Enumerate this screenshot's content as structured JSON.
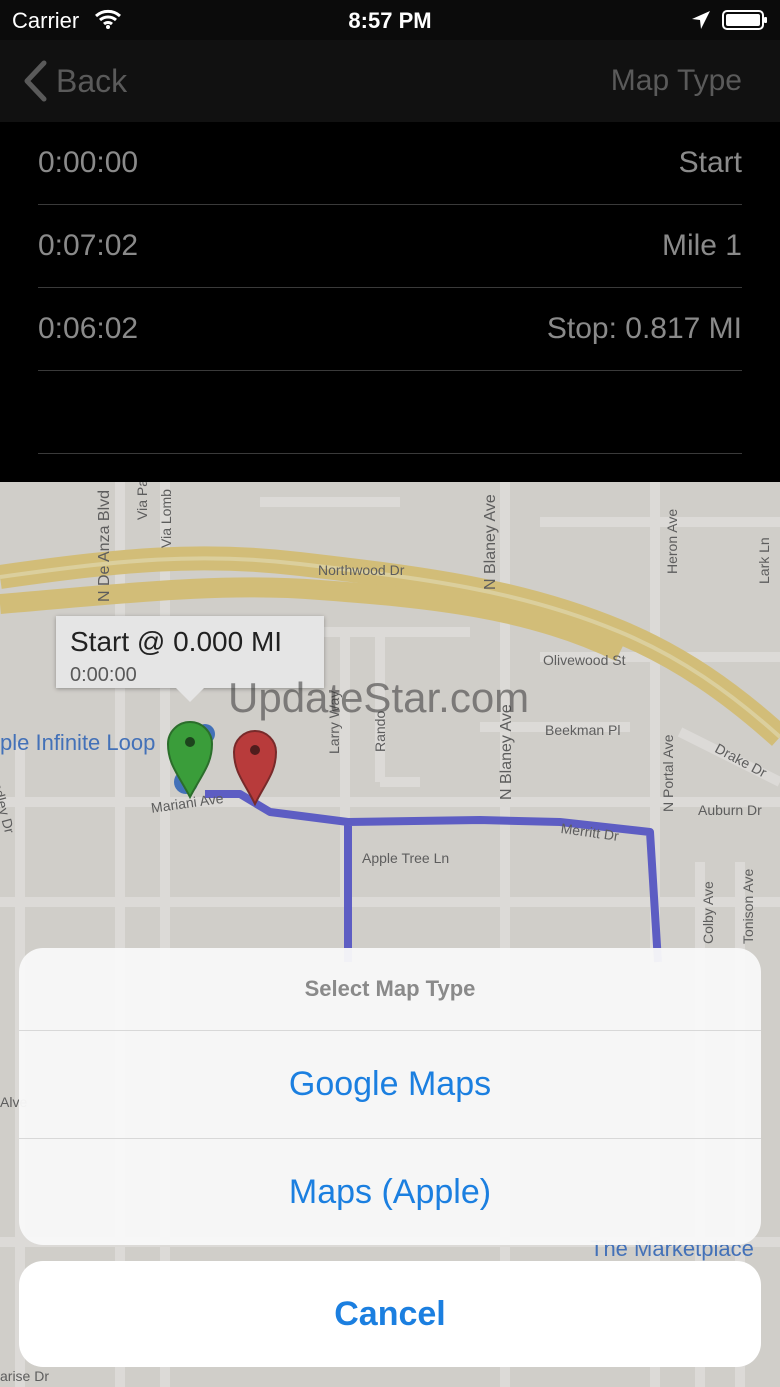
{
  "status_bar": {
    "carrier": "Carrier",
    "time": "8:57 PM",
    "icons": [
      "wifi-icon",
      "location-arrow-icon",
      "battery-icon"
    ]
  },
  "navbar": {
    "back_label": "Back",
    "map_type_label": "Map Type"
  },
  "splits": [
    {
      "time": "0:00:00",
      "label": "Start"
    },
    {
      "time": "0:07:02",
      "label": "Mile 1"
    },
    {
      "time": "0:06:02",
      "label": "Stop: 0.817 MI"
    },
    {
      "time": "",
      "label": ""
    }
  ],
  "map": {
    "callout_title": "Start @ 0.000 MI",
    "callout_subtitle": "0:00:00",
    "watermark": "UpdateStar.com",
    "poi_label": "ple Infinite Loop",
    "marketplace_label": "The Marketplace",
    "streets": [
      "N De Anza Blvd",
      "Via Pa",
      "Via Lomb",
      "Northwood Dr",
      "N Blaney Ave",
      "Heron Ave",
      "Lark Ln",
      "Olivewood St",
      "Larry Way",
      "Rando",
      "N Blaney Ave",
      "Beekman Pl",
      "N Portal Ave",
      "Drake Dr",
      "Auburn Dr",
      "Mariani Ave",
      "Merritt Dr",
      "Apple Tree Ln",
      "Bandley Dr",
      "Colby Ave",
      "Tonison Ave",
      "Alve",
      "arise Dr"
    ],
    "colors": {
      "route": "#5a5ad6",
      "start_pin": "#2fa82f",
      "stop_pin": "#c83030",
      "highway": "#e8cf7a"
    }
  },
  "action_sheet": {
    "title": "Select Map Type",
    "options": [
      "Google Maps",
      "Maps (Apple)"
    ],
    "cancel_label": "Cancel",
    "accent": "#1b7fe0"
  }
}
